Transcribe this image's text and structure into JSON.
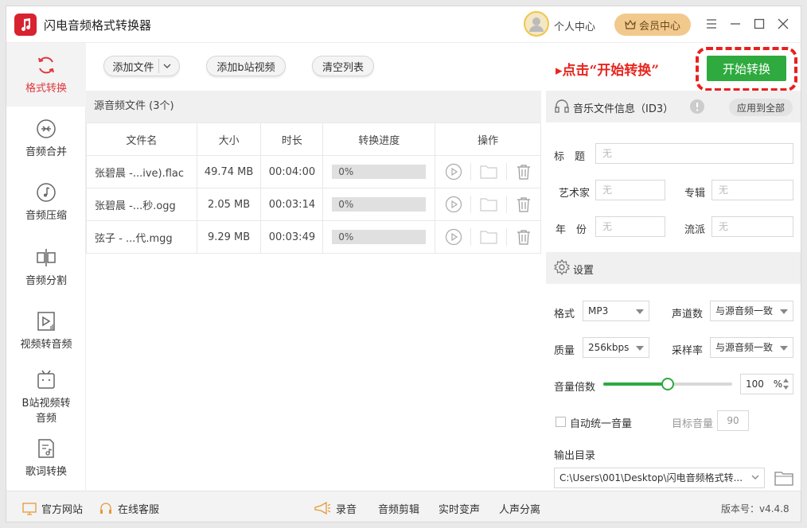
{
  "app": {
    "title": "闪电音频格式转换器"
  },
  "header": {
    "user_center": "个人中心",
    "vip_label": "会员中心"
  },
  "sidebar": {
    "items": [
      {
        "label": "格式转换",
        "icon": "refresh-cycle-icon",
        "active": true
      },
      {
        "label": "音频合并",
        "icon": "merge-icon"
      },
      {
        "label": "音频压缩",
        "icon": "music-note-icon"
      },
      {
        "label": "音频分割",
        "icon": "split-icon"
      },
      {
        "label": "视频转音频",
        "icon": "video-audio-icon"
      },
      {
        "label": "B站视频转",
        "label2": "音频",
        "icon": "bilibili-tv-icon"
      },
      {
        "label": "歌词转换",
        "icon": "lyrics-icon"
      }
    ]
  },
  "toolbar": {
    "add_file": "添加文件",
    "add_bilibili": "添加b站视频",
    "clear_list": "清空列表"
  },
  "hint": "▸点击“开始转换”",
  "start_button": "开始转换",
  "file_list": {
    "header": "源音频文件 (3个)",
    "columns": [
      "文件名",
      "大小",
      "时长",
      "转换进度",
      "操作"
    ],
    "rows": [
      {
        "name": "张碧晨 -...ive).flac",
        "size": "49.74 MB",
        "duration": "00:04:00",
        "progress": "0%"
      },
      {
        "name": "张碧晨 -...秒.ogg",
        "size": "2.05 MB",
        "duration": "00:03:14",
        "progress": "0%"
      },
      {
        "name": "弦子 - ...代.mgg",
        "size": "9.29 MB",
        "duration": "00:03:49",
        "progress": "0%"
      }
    ]
  },
  "music_info": {
    "header": "音乐文件信息（ID3）",
    "apply_all": "应用到全部",
    "title_label": "标　题",
    "artist_label": "艺术家",
    "album_label": "专辑",
    "year_label": "年　份",
    "genre_label": "流派",
    "empty_value": "无"
  },
  "settings": {
    "header": "设置",
    "format_label": "格式",
    "format_value": "MP3",
    "channel_label": "声道数",
    "channel_value": "与源音频一致",
    "quality_label": "质量",
    "quality_value": "256kbps",
    "sample_label": "采样率",
    "sample_value": "与源音频一致",
    "volume_label": "音量倍数",
    "volume_value": "100",
    "volume_unit": "%",
    "volume_fraction": 0.5,
    "auto_volume_label": "自动统一音量",
    "target_volume_label": "目标音量",
    "target_volume_value": "90",
    "output_label": "输出目录",
    "output_path": "C:\\Users\\001\\Desktop\\闪电音频格式转..."
  },
  "statusbar": {
    "website": "官方网站",
    "support": "在线客服",
    "record": "录音",
    "edit": "音频剪辑",
    "voice_change": "实时变声",
    "vocal_split": "人声分离",
    "version": "版本号：v4.4.8"
  },
  "colors": {
    "accent_red": "#e0383e",
    "green": "#2eaa3e",
    "gold": "#f2c98d"
  }
}
